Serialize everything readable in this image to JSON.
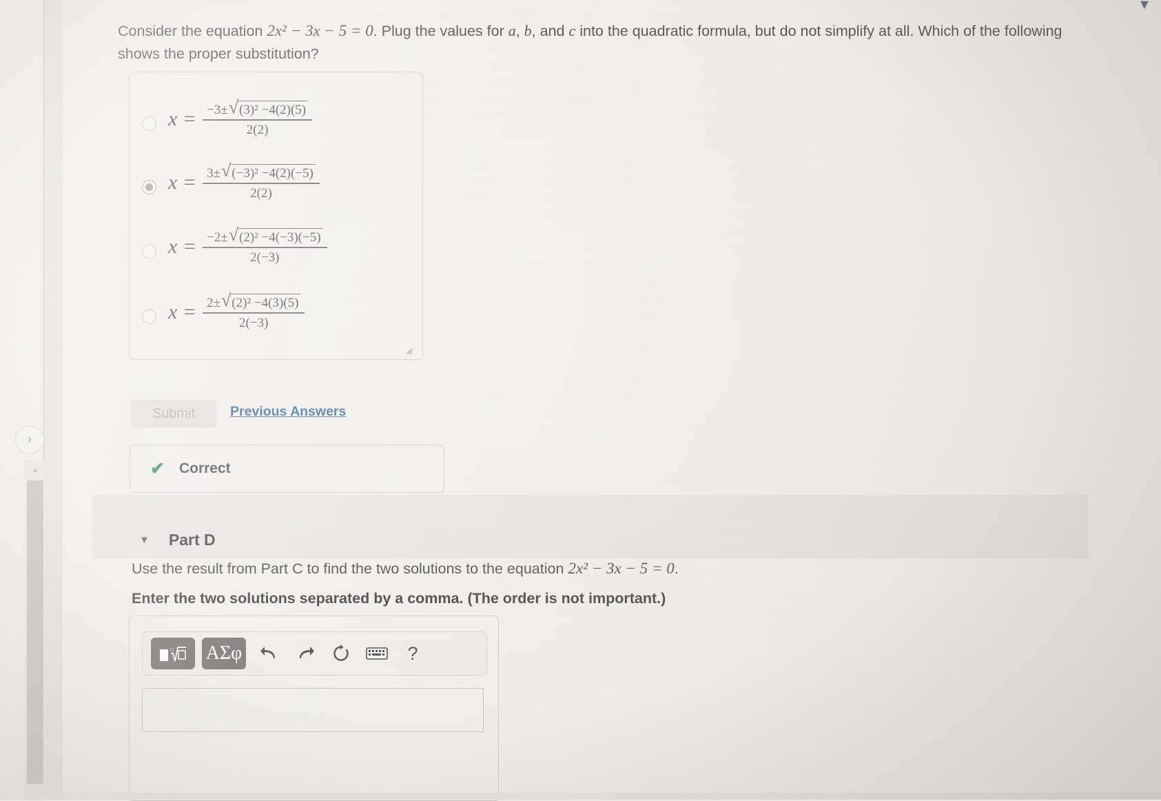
{
  "question": {
    "stem_part1": "Consider the equation ",
    "equation": "2x² − 3x − 5 = 0",
    "stem_part2": ". Plug the values for ",
    "var_a": "a",
    "var_b": "b",
    "stem_and": ", and ",
    "var_c": "c",
    "stem_part3": " into the quadratic formula, but do not simplify at all. Which of the following shows the proper substitution?"
  },
  "choices": [
    {
      "id": "choice-a",
      "selected": false,
      "lhs": "x =",
      "numerator_lead": "−3±",
      "radicand": "(3)² −4(2)(5)",
      "denominator": "2(2)"
    },
    {
      "id": "choice-b",
      "selected": true,
      "lhs": "x =",
      "numerator_lead": "3±",
      "radicand": "(−3)² −4(2)(−5)",
      "denominator": "2(2)"
    },
    {
      "id": "choice-c",
      "selected": false,
      "lhs": "x =",
      "numerator_lead": "−2±",
      "radicand": "(2)² −4(−3)(−5)",
      "denominator": "2(−3)"
    },
    {
      "id": "choice-d",
      "selected": false,
      "lhs": "x =",
      "numerator_lead": "2±",
      "radicand": "(2)² −4(3)(5)",
      "denominator": "2(−3)"
    }
  ],
  "actions": {
    "submit_label": "Submit",
    "previous_answers_label": "Previous Answers"
  },
  "feedback": {
    "icon": "check-icon",
    "label": "Correct",
    "color": "#1d7a42"
  },
  "part_d": {
    "caret": "▼",
    "title": "Part D",
    "instruction_lead": "Use the result from Part C to find the two solutions to the equation ",
    "instruction_equation": "2x² − 3x − 5 = 0",
    "instruction_tail": ".",
    "emphasis": "Enter the two solutions separated by a comma. (The order is not important.)"
  },
  "toolbar": {
    "template_button": "□ ⁿ√□",
    "greek_button": "ΑΣφ",
    "undo": "↰",
    "redo": "↱",
    "reset": "↻",
    "keyboard": "⌨",
    "help": "?"
  },
  "answer_field": {
    "value": "",
    "placeholder": ""
  },
  "sidebar": {
    "expand_icon": "›",
    "scroll_up_icon": "▲"
  },
  "colors": {
    "link": "#1c4f8b",
    "correct_green": "#1d7a42",
    "page_bg": "#eeece8",
    "toolbar_dark": "#5e5c59"
  }
}
